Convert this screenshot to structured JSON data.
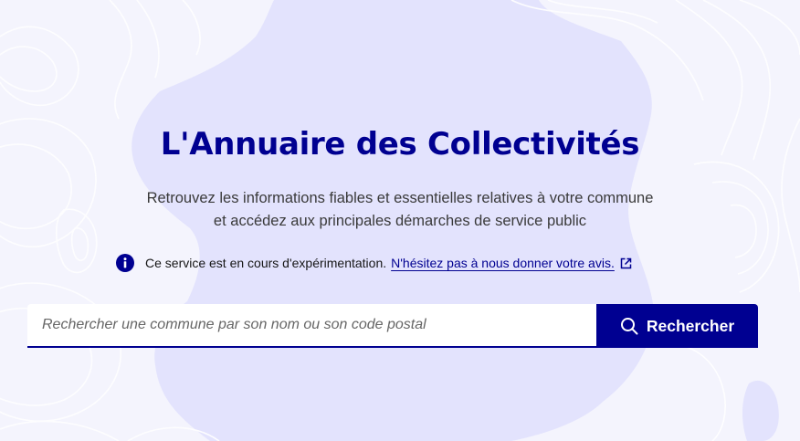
{
  "colors": {
    "primary": "#000091",
    "background": "#f4f4fd",
    "map_shape": "#e3e3fd",
    "contour_lines": "#ffffff"
  },
  "hero": {
    "title": "L'Annuaire des Collectivités",
    "subtitle_line1": "Retrouvez les informations fiables et essentielles relatives à votre commune",
    "subtitle_line2": "et accédez aux principales démarches de service public"
  },
  "notice": {
    "icon": "info-icon",
    "text": "Ce service est en cours d'expérimentation.",
    "link_text": "N'hésitez pas à nous donner votre avis.",
    "link_icon": "external-link-icon"
  },
  "search": {
    "placeholder": "Rechercher une commune par son nom ou son code postal",
    "value": "",
    "button_label": "Rechercher",
    "button_icon": "search-icon"
  }
}
